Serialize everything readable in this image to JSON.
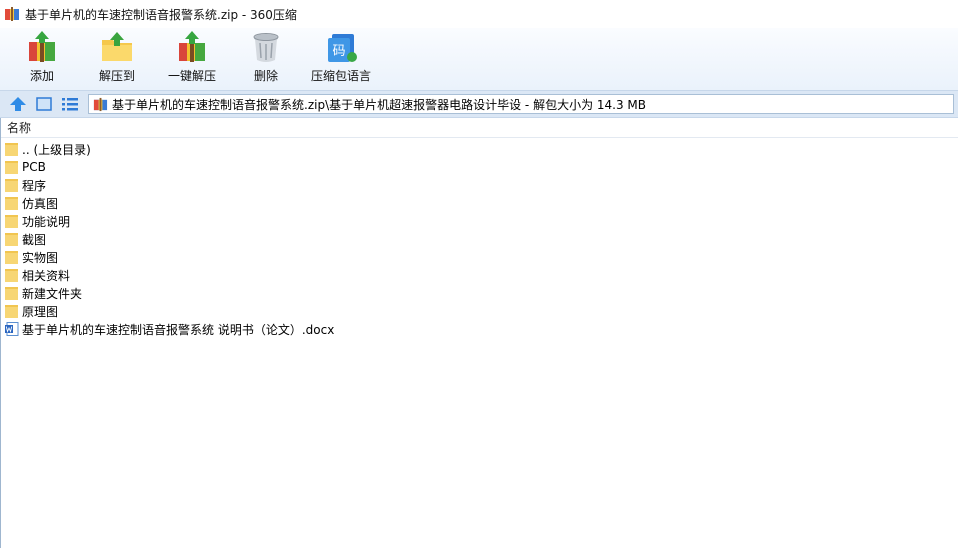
{
  "window": {
    "title": "基于单片机的车速控制语音报警系统.zip - 360压缩"
  },
  "toolbar": {
    "add_label": "添加",
    "extract_to_label": "解压到",
    "one_click_extract_label": "一键解压",
    "delete_label": "删除",
    "language_label": "压缩包语言",
    "language_icon_char": "码"
  },
  "address": {
    "path": "基于单片机的车速控制语音报警系统.zip\\基于单片机超速报警器电路设计毕设 - 解包大小为 14.3 MB"
  },
  "list": {
    "column_name": "名称",
    "items": [
      {
        "name": ".. (上级目录)",
        "type": "folder"
      },
      {
        "name": "PCB",
        "type": "folder"
      },
      {
        "name": "程序",
        "type": "folder"
      },
      {
        "name": "仿真图",
        "type": "folder"
      },
      {
        "name": "功能说明",
        "type": "folder"
      },
      {
        "name": "截图",
        "type": "folder"
      },
      {
        "name": "实物图",
        "type": "folder"
      },
      {
        "name": "相关资料",
        "type": "folder"
      },
      {
        "name": "新建文件夹",
        "type": "folder"
      },
      {
        "name": "原理图",
        "type": "folder"
      },
      {
        "name": "基于单片机的车速控制语音报警系统 说明书（论文）.docx",
        "type": "docx"
      }
    ]
  },
  "colors": {
    "folder": "#f7d674",
    "accent": "#2f7bd6",
    "toolbar_bg": "#eaf2fb"
  }
}
